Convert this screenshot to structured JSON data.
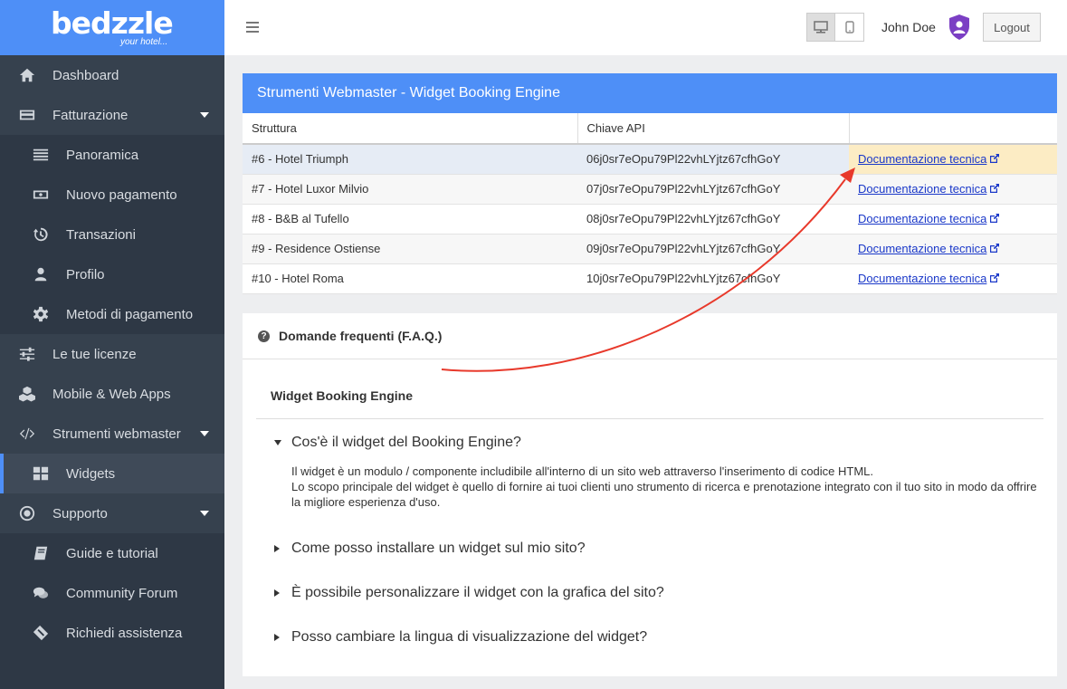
{
  "brand": {
    "logo": "bedzzle",
    "tagline": "your hotel..."
  },
  "sidebar": {
    "items": [
      {
        "label": "Dashboard",
        "icon": "home-icon"
      },
      {
        "label": "Fatturazione",
        "icon": "credit-card-icon",
        "expanded": true
      },
      {
        "label": "Panoramica",
        "icon": "list-icon"
      },
      {
        "label": "Nuovo pagamento",
        "icon": "money-icon"
      },
      {
        "label": "Transazioni",
        "icon": "history-icon"
      },
      {
        "label": "Profilo",
        "icon": "user-icon"
      },
      {
        "label": "Metodi di pagamento",
        "icon": "gear-icon"
      },
      {
        "label": "Le tue licenze",
        "icon": "sliders-icon"
      },
      {
        "label": "Mobile & Web Apps",
        "icon": "cubes-icon"
      },
      {
        "label": "Strumenti webmaster",
        "icon": "code-icon",
        "expanded": true
      },
      {
        "label": "Widgets",
        "icon": "grid-icon",
        "active": true
      },
      {
        "label": "Supporto",
        "icon": "lifebuoy-icon",
        "expanded": true
      },
      {
        "label": "Guide e tutorial",
        "icon": "book-icon"
      },
      {
        "label": "Community Forum",
        "icon": "comments-icon"
      },
      {
        "label": "Richiedi assistenza",
        "icon": "ticket-icon"
      }
    ]
  },
  "topbar": {
    "username": "John Doe",
    "logout_label": "Logout",
    "view_mode": "desktop"
  },
  "panel": {
    "title": "Strumenti Webmaster - Widget Booking Engine",
    "columns": [
      "Struttura",
      "Chiave API",
      ""
    ],
    "rows": [
      {
        "struttura": "#6 - Hotel Triumph",
        "chiave": "06j0sr7eOpu79Pl22vhLYjtz67cfhGoY",
        "link": "Documentazione tecnica"
      },
      {
        "struttura": "#7 - Hotel Luxor Milvio",
        "chiave": "07j0sr7eOpu79Pl22vhLYjtz67cfhGoY",
        "link": "Documentazione tecnica"
      },
      {
        "struttura": "#8 - B&B al Tufello",
        "chiave": "08j0sr7eOpu79Pl22vhLYjtz67cfhGoY",
        "link": "Documentazione tecnica"
      },
      {
        "struttura": "#9 - Residence Ostiense",
        "chiave": "09j0sr7eOpu79Pl22vhLYjtz67cfhGoY",
        "link": "Documentazione tecnica"
      },
      {
        "struttura": "#10 - Hotel Roma",
        "chiave": "10j0sr7eOpu79Pl22vhLYjtz67cfhGoY",
        "link": "Documentazione tecnica"
      }
    ]
  },
  "faq": {
    "title": "Domande frequenti (F.A.Q.)",
    "section": "Widget Booking Engine",
    "items": [
      {
        "question": "Cos'è il widget del Booking Engine?",
        "expanded": true,
        "answer_1": "Il widget è un modulo / componente includibile all'interno di un sito web attraverso l'inserimento di codice HTML.",
        "answer_2": "Lo scopo principale del widget è quello di fornire ai tuoi clienti uno strumento di ricerca e prenotazione integrato con il tuo sito in modo da offrire la migliore esperienza d'uso."
      },
      {
        "question": "Come posso installare un widget sul mio sito?",
        "expanded": false
      },
      {
        "question": "È possibile personalizzare il widget con la grafica del sito?",
        "expanded": false
      },
      {
        "question": "Posso cambiare la lingua di visualizzazione del widget?",
        "expanded": false
      }
    ]
  },
  "colors": {
    "accent": "#4e8ff7",
    "sidebar_bg": "#2e3845",
    "highlight": "#fcecc4",
    "link": "#1a38c9",
    "annotation_arrow": "#e8392b",
    "shield": "#7b3fc4"
  }
}
